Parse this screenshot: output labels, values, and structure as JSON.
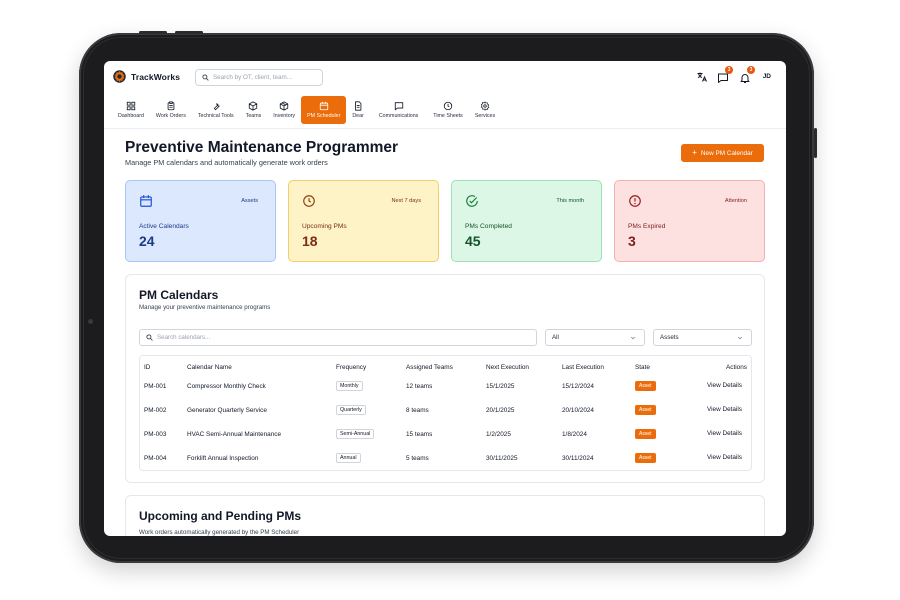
{
  "app": {
    "brand": "TrackWorks",
    "user_initials": "JD"
  },
  "search": {
    "placeholder": "Search by OT, client, team..."
  },
  "header": {
    "icons": [
      {
        "name": "translate-icon"
      },
      {
        "name": "chat-icon",
        "badge": "3"
      },
      {
        "name": "bell-icon",
        "badge": "3"
      }
    ]
  },
  "nav": {
    "items": [
      {
        "label": "Dashboard",
        "icon": "dashboard-icon"
      },
      {
        "label": "Work Orders",
        "icon": "clipboard-icon"
      },
      {
        "label": "Technical Tools",
        "icon": "wrench-icon"
      },
      {
        "label": "Teams",
        "icon": "cube-icon"
      },
      {
        "label": "Inventory",
        "icon": "box-icon"
      },
      {
        "label": "PM Scheduler",
        "icon": "calendar-icon",
        "active": true
      },
      {
        "label": "Dear",
        "icon": "document-icon"
      },
      {
        "label": "Communications",
        "icon": "message-icon"
      },
      {
        "label": "Time Sheets",
        "icon": "clock-icon"
      },
      {
        "label": "Services",
        "icon": "gear-icon"
      }
    ]
  },
  "page": {
    "title": "Preventive Maintenance Programmer",
    "subtitle": "Manage PM calendars and automatically generate work orders",
    "new_button": "New PM Calendar"
  },
  "stats": [
    {
      "label": "Active Calendars",
      "value": "24",
      "tag": "Assets",
      "icon": "calendar-icon",
      "bg": "#dbe8fd",
      "border": "#a9c6f7",
      "accent": "#1e3a8a"
    },
    {
      "label": "Upcoming PMs",
      "value": "18",
      "tag": "Next 7 days",
      "icon": "clock-icon",
      "bg": "#fdf3c7",
      "border": "#f3cf6b",
      "accent": "#7c2d12"
    },
    {
      "label": "PMs Completed",
      "value": "45",
      "tag": "This month",
      "icon": "check-circle-icon",
      "bg": "#dcf7e5",
      "border": "#9fe0b5",
      "accent": "#14532d"
    },
    {
      "label": "PMs Expired",
      "value": "3",
      "tag": "Attention",
      "icon": "alert-circle-icon",
      "bg": "#fde1e1",
      "border": "#f5b0b0",
      "accent": "#7f1d1d"
    }
  ],
  "calendars": {
    "title": "PM Calendars",
    "subtitle": "Manage your preventive maintenance programs",
    "search_placeholder": "Search calendars...",
    "filter_value": "All",
    "type_value": "Assets",
    "columns": [
      "ID",
      "Calendar Name",
      "Frequency",
      "Assigned Teams",
      "Next Execution",
      "Last Execution",
      "State",
      "Actions"
    ],
    "rows": [
      {
        "id": "PM-001",
        "name": "Compressor Monthly Check",
        "frequency": "Monthly",
        "teams": "12 teams",
        "next": "15/1/2025",
        "last": "15/12/2024",
        "state": "Asset",
        "action": "View Details"
      },
      {
        "id": "PM-002",
        "name": "Generator Quarterly Service",
        "frequency": "Quarterly",
        "teams": "8 teams",
        "next": "20/1/2025",
        "last": "20/10/2024",
        "state": "Asset",
        "action": "View Details"
      },
      {
        "id": "PM-003",
        "name": "HVAC Semi-Annual Maintenance",
        "frequency": "Semi-Annual",
        "teams": "15 teams",
        "next": "1/2/2025",
        "last": "1/8/2024",
        "state": "Asset",
        "action": "View Details"
      },
      {
        "id": "PM-004",
        "name": "Forklift Annual Inspection",
        "frequency": "Annual",
        "teams": "5 teams",
        "next": "30/11/2025",
        "last": "30/11/2024",
        "state": "Asset",
        "action": "View Details"
      }
    ]
  },
  "upcoming": {
    "title": "Upcoming and Pending PMs",
    "subtitle": "Work orders automatically generated by the PM Scheduler"
  },
  "colors": {
    "accent": "#ea6c0a"
  }
}
